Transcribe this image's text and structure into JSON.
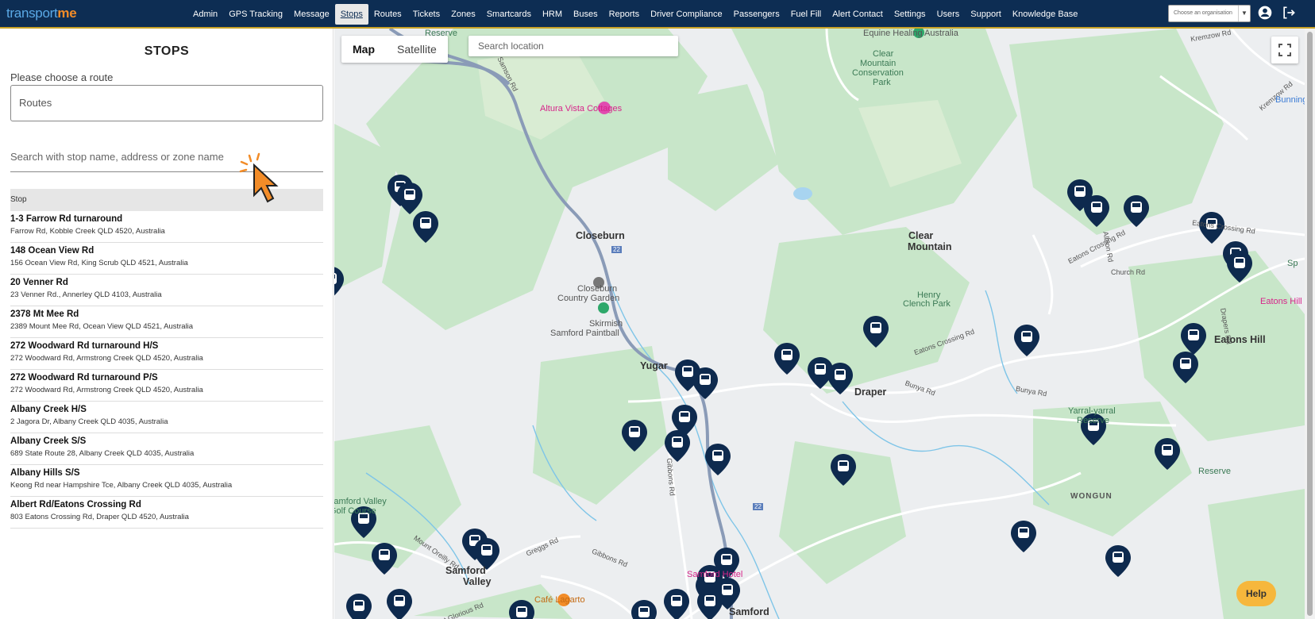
{
  "app": {
    "logo_a": "transport",
    "logo_b": "me"
  },
  "nav": [
    {
      "label": "Admin"
    },
    {
      "label": "GPS Tracking"
    },
    {
      "label": "Message"
    },
    {
      "label": "Stops",
      "active": true
    },
    {
      "label": "Routes"
    },
    {
      "label": "Tickets"
    },
    {
      "label": "Zones"
    },
    {
      "label": "Smartcards"
    },
    {
      "label": "HRM"
    },
    {
      "label": "Buses"
    },
    {
      "label": "Reports"
    },
    {
      "label": "Driver Compliance"
    },
    {
      "label": "Passengers"
    },
    {
      "label": "Fuel Fill"
    },
    {
      "label": "Alert Contact"
    },
    {
      "label": "Settings"
    },
    {
      "label": "Users"
    },
    {
      "label": "Support"
    },
    {
      "label": "Knowledge Base"
    }
  ],
  "org_select": {
    "placeholder": "Choose an organisation"
  },
  "panel": {
    "title": "STOPS",
    "route_label": "Please choose a route",
    "route_value": "Routes",
    "search_placeholder": "Search with stop name, address or zone name",
    "column_header": "Stop",
    "stops": [
      {
        "name": "1-3 Farrow Rd turnaround",
        "address": "Farrow Rd, Kobble Creek QLD 4520, Australia"
      },
      {
        "name": "148 Ocean View Rd",
        "address": "156 Ocean View Rd, King Scrub QLD 4521, Australia"
      },
      {
        "name": "20 Venner Rd",
        "address": "23 Venner Rd., Annerley QLD 4103, Australia"
      },
      {
        "name": "2378 Mt Mee Rd",
        "address": "2389 Mount Mee Rd, Ocean View QLD 4521, Australia"
      },
      {
        "name": "272 Woodward Rd turnaround H/S",
        "address": "272 Woodward Rd, Armstrong Creek QLD 4520, Australia"
      },
      {
        "name": "272 Woodward Rd turnaround P/S",
        "address": "272 Woodward Rd, Armstrong Creek QLD 4520, Australia"
      },
      {
        "name": "Albany Creek H/S",
        "address": "2 Jagora Dr, Albany Creek QLD 4035, Australia"
      },
      {
        "name": "Albany Creek S/S",
        "address": "689 State Route 28, Albany Creek QLD 4035, Australia"
      },
      {
        "name": "Albany Hills S/S",
        "address": "Keong Rd near Hampshire Tce, Albany Creek QLD 4035, Australia"
      },
      {
        "name": "Albert Rd/Eatons Crossing Rd",
        "address": "803 Eatons Crossing Rd, Draper QLD 4520, Australia"
      }
    ]
  },
  "map": {
    "toggle": {
      "map": "Map",
      "satellite": "Satellite"
    },
    "search_placeholder": "Search location",
    "help_label": "Help",
    "places": {
      "equine": "Equine Healing Australia",
      "clear_mountain_park_1": "Clear",
      "clear_mountain_park_2": "Mountain",
      "clear_mountain_park_3": "Conservation",
      "clear_mountain_park_4": "Park",
      "altura": "Altura Vista Cottages",
      "samson": "Mount Samson Rd",
      "closeburn": "Closeburn",
      "closeburn_cg_1": "Closeburn",
      "closeburn_cg_2": "Country Garden",
      "skirmish_1": "Skirmish",
      "skirmish_2": "Samford Paintball",
      "yugar": "Yugar",
      "clear_mtn_1": "Clear",
      "clear_mtn_2": "Mountain",
      "henry_1": "Henry",
      "henry_2": "Clench Park",
      "draper": "Draper",
      "eatons_hill_1": "Eatons Hill",
      "eatons_hill_2": "Eatons Hill",
      "eatons_crossing_1": "Eatons Crossing Rd",
      "eatons_crossing_2": "Eatons Crossing Rd",
      "eatons_crossing_3": "Eatons Crossing Rd",
      "church": "Church Rd",
      "albion": "Albion Rd",
      "drapers": "Drapers Rd",
      "bunya_1": "Bunya Rd",
      "bunya_2": "Bunya Rd",
      "yarral_1": "Yarral-yarral",
      "yarral_2": "Reserve",
      "wongun": "WONGUN",
      "samford_valley_1": "Samford",
      "samford_valley_2": "Valley",
      "golf_1": "Samford Valley",
      "golf_2": "Golf Course",
      "samford_hotel": "Samford Hotel",
      "cafe": "Café Lagarto",
      "samford": "Samford",
      "gibbons_1": "Gibbons Rd",
      "gibbons_2": "Gibbons Rd",
      "greggs": "Greggs Rd",
      "reilly": "Mount Oreilly Rd",
      "glorious": "Mount Glorious Rd",
      "kremzow_1": "Kremzow Rd",
      "kremzow_2": "Kremzow Rd",
      "bunnings": "Bunnings",
      "reserve_top": "Reserve",
      "reserve_right": "Reserve",
      "road_22a": "22",
      "road_22b": "22",
      "sp": "Sp"
    }
  }
}
